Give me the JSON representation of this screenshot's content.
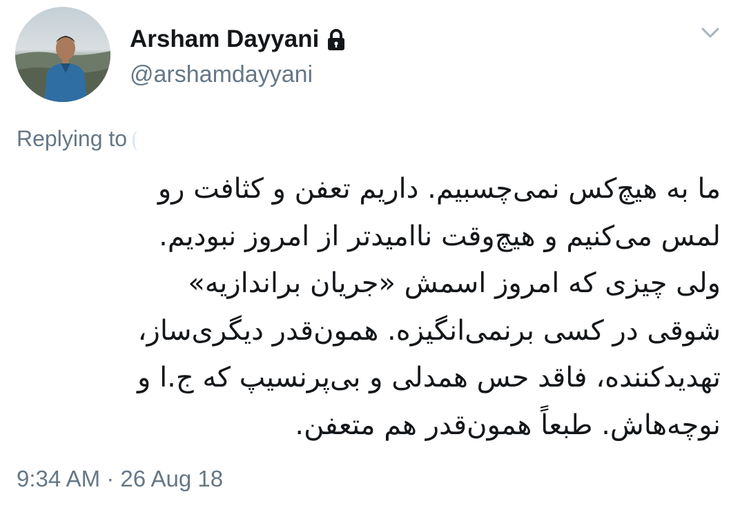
{
  "tweet": {
    "author": {
      "name": "Arsham Dayyani",
      "handle": "@arshamdayyani",
      "protected_icon": "lock-icon"
    },
    "menu_icon": "chevron-down-icon",
    "replying_to_label": "Replying to",
    "body_lines": [
      "ما به هیچ‌کس نمی‌چسبیم. داریم تعفن و کثافت رو",
      "لمس می‌کنیم و هیچ‌وقت ناامیدتر از امروز نبودیم.",
      "ولی چیزی که امروز اسمش «جریان براندازیه»",
      "شوقی در کسی برنمی‌انگیزه. همون‌قدر دیگری‌ساز،",
      "تهدیدکننده، فاقد حس همدلی و بی‌پرنسیپ که ج.ا و",
      "نوچه‌هاش. طبعاً همون‌قدر هم متعفن."
    ],
    "timestamp": "9:34 AM · 26 Aug 18"
  },
  "colors": {
    "name": "#14171a",
    "secondary": "#657786",
    "background": "#ffffff"
  }
}
